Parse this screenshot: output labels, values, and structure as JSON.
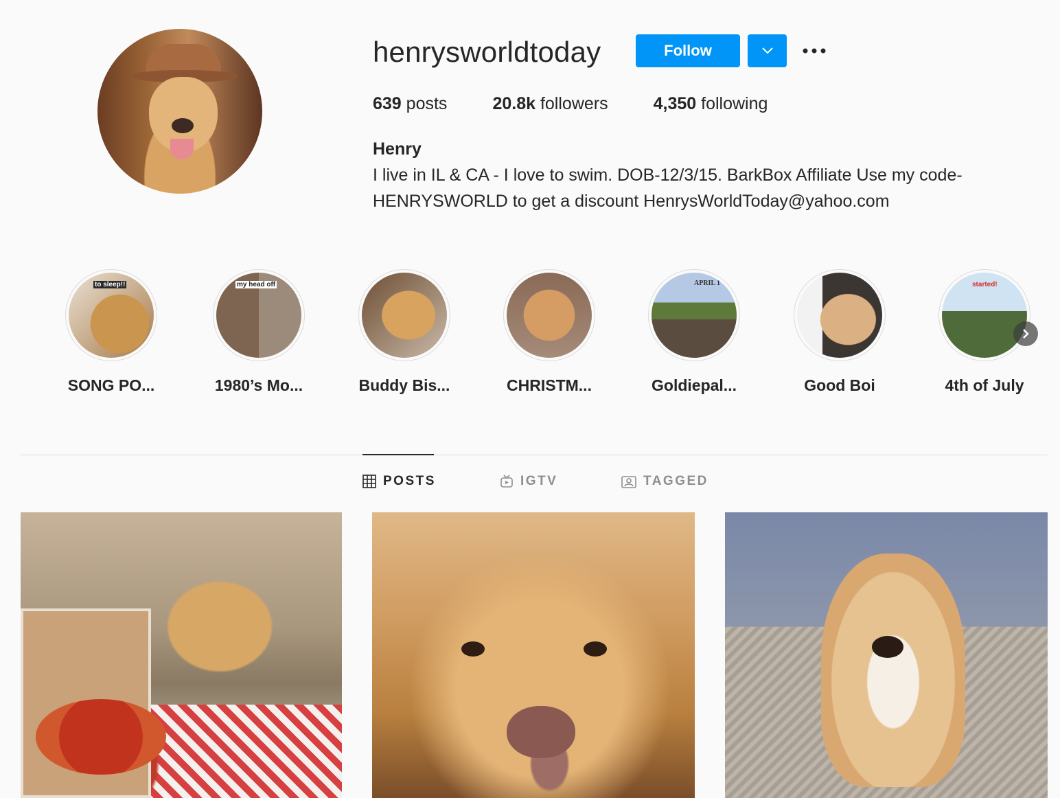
{
  "profile": {
    "username": "henrysworldtoday",
    "follow_label": "Follow",
    "posts_count": "639",
    "posts_label": "posts",
    "followers_count": "20.8k",
    "followers_label": "followers",
    "following_count": "4,350",
    "following_label": "following",
    "full_name": "Henry",
    "bio_line1": "I live in IL & CA - I love to swim. DOB-12/3/15. BarkBox Affiliate Use my code-",
    "bio_line2": "HENRYSWORLD to get a discount HenrysWorldToday@yahoo.com"
  },
  "colors": {
    "accent": "#0095f6",
    "text": "#262626",
    "muted": "#8e8e8e",
    "border": "#dbdbdb",
    "background": "#fafafa"
  },
  "highlights": [
    {
      "label": "SONG PO...",
      "overlay": "to sleep!!"
    },
    {
      "label": "1980’s Mo...",
      "overlay": "my head off"
    },
    {
      "label": "Buddy Bis..."
    },
    {
      "label": "CHRISTM..."
    },
    {
      "label": "Goldiepal...",
      "overlay": "APRIL 1"
    },
    {
      "label": "Good Boi"
    },
    {
      "label": "4th of July",
      "overlay": "started!"
    }
  ],
  "tabs": [
    {
      "label": "POSTS",
      "icon": "grid-icon",
      "active": true
    },
    {
      "label": "IGTV",
      "icon": "igtv-icon",
      "active": false
    },
    {
      "label": "TAGGED",
      "icon": "tagged-icon",
      "active": false
    }
  ],
  "icons": {
    "dropdown": "chevron-down-icon",
    "more": "more-options-icon",
    "next": "chevron-right-icon"
  }
}
